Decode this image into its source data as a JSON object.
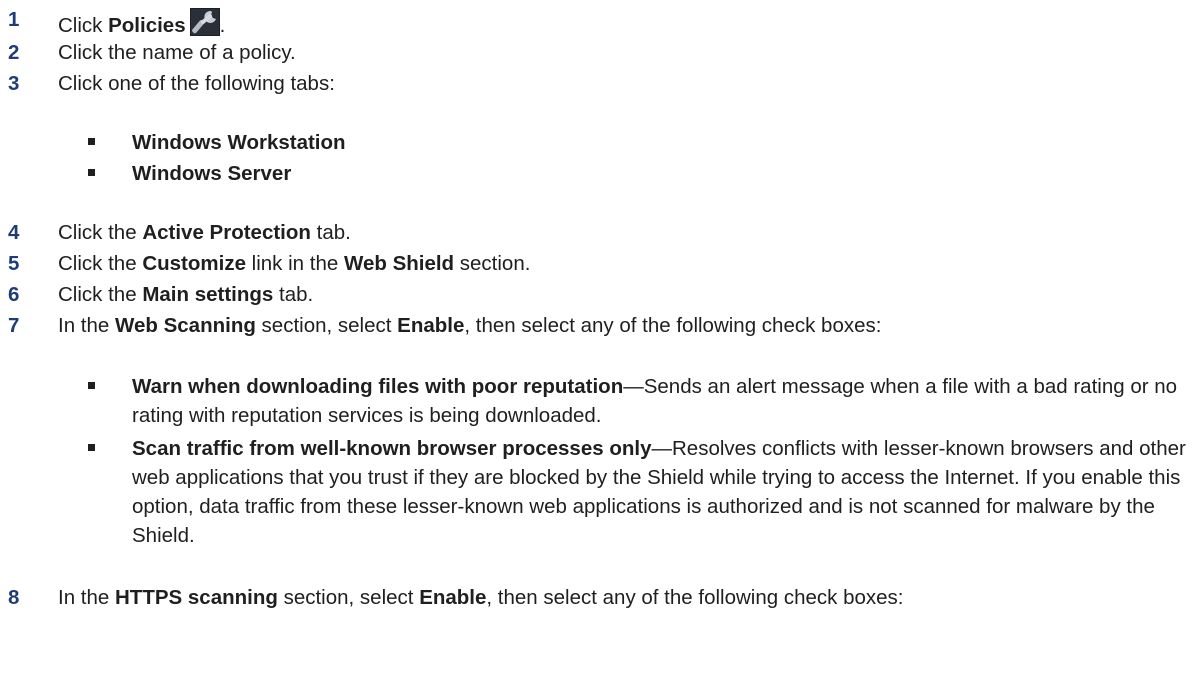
{
  "steps": [
    {
      "num": "1",
      "pre": "Click ",
      "b1": "Policies",
      "post": "."
    },
    {
      "num": "2",
      "text": "Click the name of a policy."
    },
    {
      "num": "3",
      "text": "Click one of the following tabs:"
    },
    {
      "num": "4",
      "pre": "Click the ",
      "b1": "Active Protection",
      "post": " tab."
    },
    {
      "num": "5",
      "pre": "Click the ",
      "b1": "Customize",
      "mid": " link in the ",
      "b2": "Web Shield",
      "post": " section."
    },
    {
      "num": "6",
      "pre": "Click the ",
      "b1": "Main settings",
      "post": " tab."
    },
    {
      "num": "7",
      "pre": "In the ",
      "b1": "Web Scanning",
      "mid": " section, select ",
      "b2": "Enable",
      "post": ", then select any of the following check boxes:"
    },
    {
      "num": "8",
      "pre": "In the ",
      "b1": "HTTPS scanning",
      "mid": " section, select ",
      "b2": "Enable",
      "post": ", then select any of the following check boxes:"
    }
  ],
  "tabs_bullets": [
    "Windows Workstation",
    "Windows Server"
  ],
  "checkbox_bullets": [
    {
      "label": "Warn when downloading files with poor reputation",
      "desc": "—Sends an alert message when a file with a bad rating or no rating with reputation services is being downloaded."
    },
    {
      "label": "Scan traffic from well-known browser processes only",
      "desc": "—Resolves conflicts with lesser-known browsers and other web applications that you trust if they are blocked by the Shield while trying to access the Internet. If you enable this option, data traffic from these lesser-known web applications is authorized and is not scanned for malware by the Shield."
    }
  ],
  "icons": {
    "policies": "wrench-icon"
  },
  "colors": {
    "step_number": "#1f3c78",
    "text": "#1f1f1f"
  }
}
